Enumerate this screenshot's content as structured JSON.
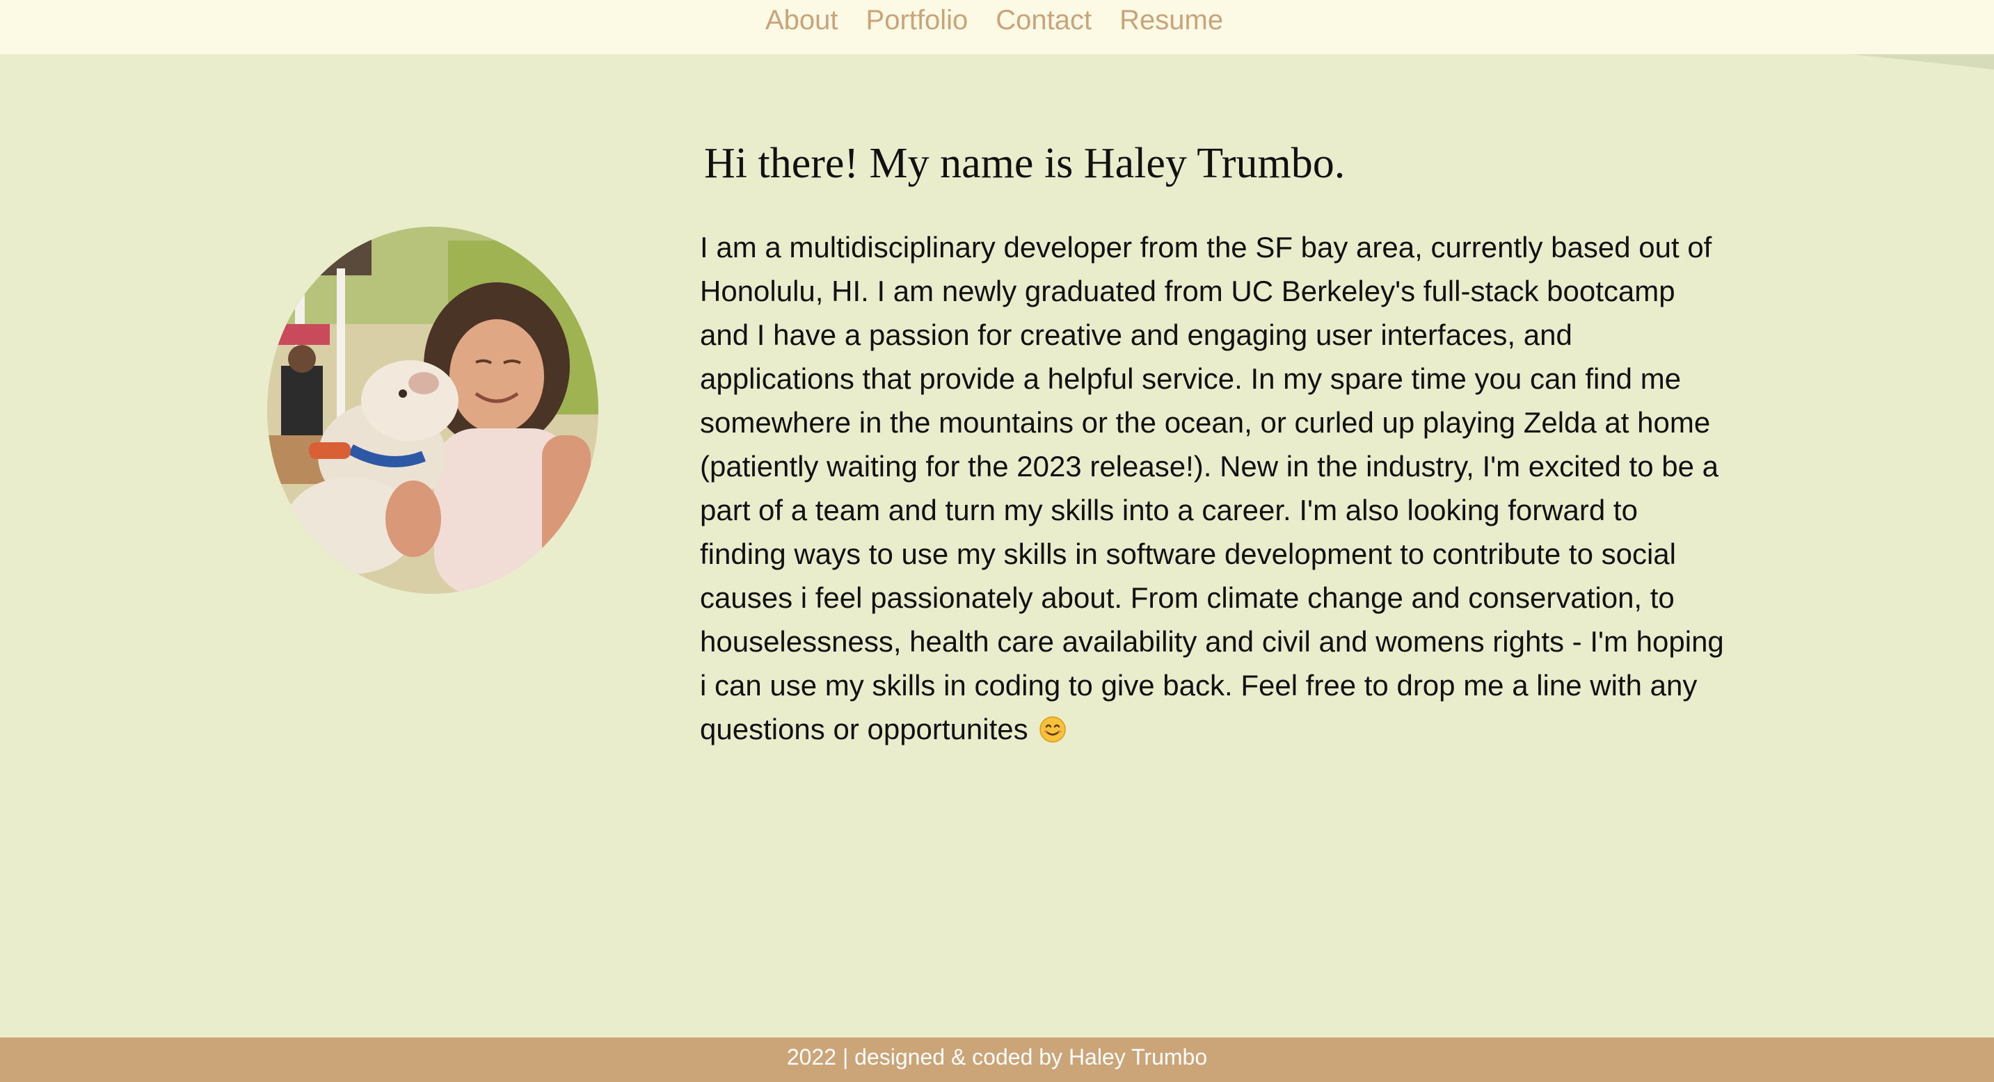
{
  "nav": {
    "items": [
      {
        "label": "About"
      },
      {
        "label": "Portfolio"
      },
      {
        "label": "Contact"
      },
      {
        "label": "Resume"
      }
    ]
  },
  "profile": {
    "photo_alt": "Haley Trumbo holding a dog",
    "heading": "Hi there! My name is Haley Trumbo.",
    "bio": "I am a multidisciplinary developer from the SF bay area, currently based out of Honolulu, HI. I am newly graduated from UC Berkeley's full-stack bootcamp and I have a passion for creative and engaging user interfaces, and applications that provide a helpful service. In my spare time you can find me somewhere in the mountains or the ocean, or curled up playing Zelda at home (patiently waiting for the 2023 release!). New in the industry, I'm excited to be a part of a team and turn my skills into a career. I'm also looking forward to finding ways to use my skills in software development to contribute to social causes i feel passionately about. From climate change and conservation, to houselessness, health care availability and civil and womens rights - I'm hoping i can use my skills in coding to give back. Feel free to drop me a line with any questions or opportunites"
  },
  "footer": {
    "text": "2022 | designed & coded by Haley Trumbo"
  },
  "colors": {
    "page_background": "#e9edcc",
    "nav_background": "#fcf9e5",
    "nav_link": "#c8a47a",
    "footer_background": "#cba577",
    "footer_text": "#ffffff"
  },
  "icons": {
    "bio_end": "smiling-face-icon"
  }
}
